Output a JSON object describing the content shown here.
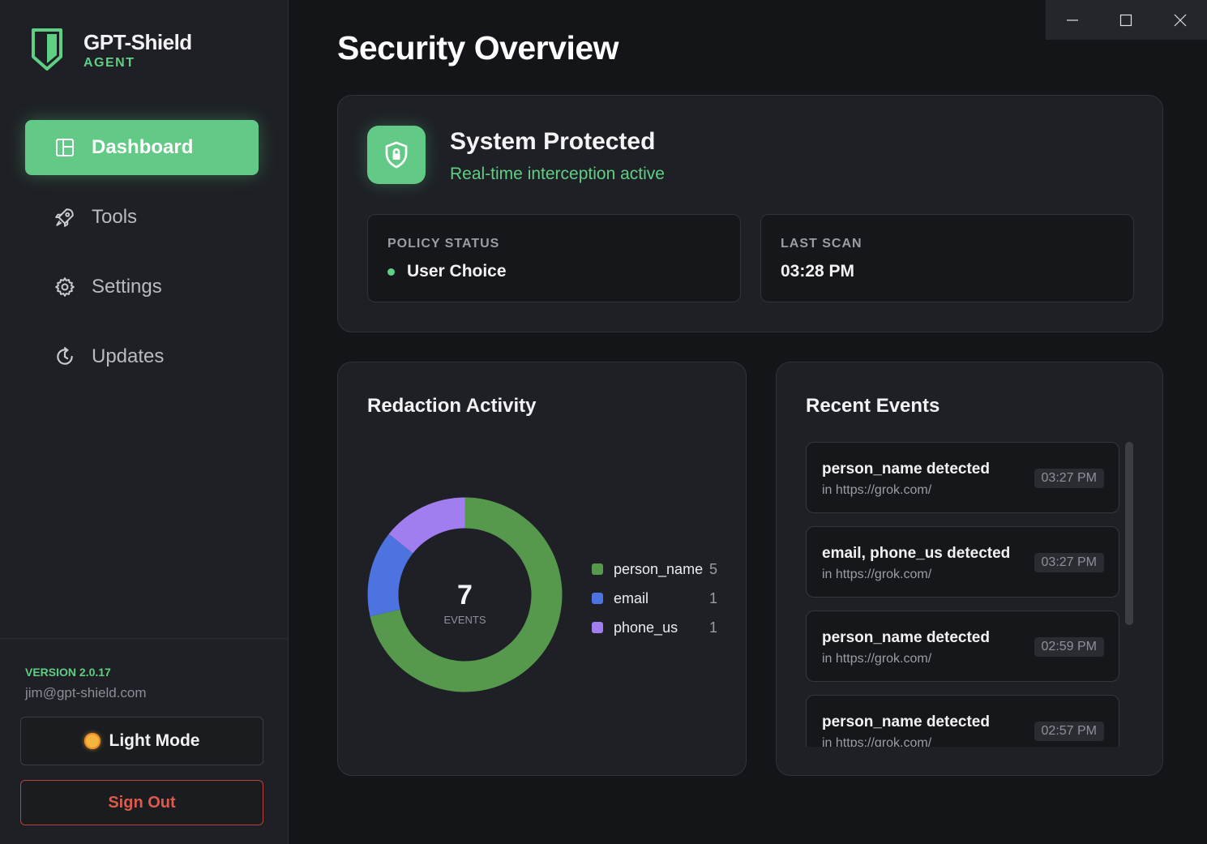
{
  "brand": {
    "title": "GPT-Shield",
    "subtitle": "AGENT"
  },
  "nav": {
    "items": [
      {
        "label": "Dashboard",
        "icon": "dashboard-icon",
        "active": true
      },
      {
        "label": "Tools",
        "icon": "rocket-icon"
      },
      {
        "label": "Settings",
        "icon": "gear-icon"
      },
      {
        "label": "Updates",
        "icon": "refresh-icon"
      }
    ]
  },
  "account": {
    "version": "VERSION 2.0.17",
    "email": "jim@gpt-shield.com",
    "mode_label": "Light Mode",
    "signout_label": "Sign Out"
  },
  "page": {
    "title": "Security Overview"
  },
  "status": {
    "title": "System Protected",
    "subtitle": "Real-time interception active",
    "policy_label": "POLICY STATUS",
    "policy_value": "User Choice",
    "scan_label": "LAST SCAN",
    "scan_value": "03:28 PM"
  },
  "activity": {
    "title": "Redaction Activity",
    "total": "7",
    "total_label": "EVENTS"
  },
  "chart_data": {
    "type": "pie",
    "categories": [
      "person_name",
      "email",
      "phone_us"
    ],
    "values": [
      5,
      1,
      1
    ],
    "colors": [
      "#56994c",
      "#4d73e0",
      "#a17ef0"
    ]
  },
  "events": {
    "title": "Recent Events",
    "items": [
      {
        "title": "person_name detected",
        "source": "in https://grok.com/",
        "time": "03:27 PM"
      },
      {
        "title": "email, phone_us detected",
        "source": "in https://grok.com/",
        "time": "03:27 PM"
      },
      {
        "title": "person_name detected",
        "source": "in https://grok.com/",
        "time": "02:59 PM"
      },
      {
        "title": "person_name detected",
        "source": "in https://grok.com/",
        "time": "02:57 PM"
      }
    ]
  },
  "colors": {
    "accent": "#63c986",
    "danger": "#dd5a4c",
    "background": "#141519"
  }
}
